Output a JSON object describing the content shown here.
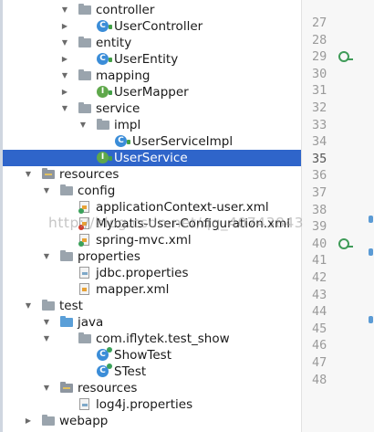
{
  "project_tree": {
    "selected_item": "UserService",
    "items": [
      {
        "label": "controller",
        "type": "folder",
        "expanded": true
      },
      {
        "label": "UserController",
        "type": "class",
        "icon": "class-icon"
      },
      {
        "label": "entity",
        "type": "folder",
        "expanded": true
      },
      {
        "label": "UserEntity",
        "type": "class",
        "icon": "class-icon"
      },
      {
        "label": "mapping",
        "type": "folder",
        "expanded": true
      },
      {
        "label": "UserMapper",
        "type": "interface",
        "icon": "interface-icon"
      },
      {
        "label": "service",
        "type": "folder",
        "expanded": true
      },
      {
        "label": "impl",
        "type": "folder",
        "expanded": true
      },
      {
        "label": "UserServiceImpl",
        "type": "class",
        "icon": "class-icon"
      },
      {
        "label": "UserService",
        "type": "interface",
        "icon": "interface-icon"
      },
      {
        "label": "resources",
        "type": "resources-folder",
        "expanded": true
      },
      {
        "label": "config",
        "type": "folder",
        "expanded": true
      },
      {
        "label": "applicationContext-user.xml",
        "type": "xml",
        "icon": "spring-xml-icon"
      },
      {
        "label": "Mybatis-User-Configuration.xml",
        "type": "xml",
        "icon": "mybatis-xml-icon"
      },
      {
        "label": "spring-mvc.xml",
        "type": "xml",
        "icon": "spring-xml-icon"
      },
      {
        "label": "properties",
        "type": "folder",
        "expanded": true
      },
      {
        "label": "jdbc.properties",
        "type": "properties",
        "icon": "properties-icon"
      },
      {
        "label": "mapper.xml",
        "type": "xml",
        "icon": "xml-icon"
      },
      {
        "label": "test",
        "type": "folder",
        "expanded": true
      },
      {
        "label": "java",
        "type": "source-folder",
        "expanded": true
      },
      {
        "label": "com.iflytek.test_show",
        "type": "folder",
        "expanded": true
      },
      {
        "label": "ShowTest",
        "type": "test-class",
        "icon": "test-class-icon"
      },
      {
        "label": "STest",
        "type": "test-class",
        "icon": "test-class-icon"
      },
      {
        "label": "resources",
        "type": "resources-folder",
        "expanded": true
      },
      {
        "label": "log4j.properties",
        "type": "properties",
        "icon": "properties-icon"
      },
      {
        "label": "webapp",
        "type": "folder",
        "expanded": false
      }
    ]
  },
  "editor_gutter": {
    "line_numbers": [
      "27",
      "28",
      "29",
      "30",
      "31",
      "32",
      "33",
      "34",
      "35",
      "36",
      "37",
      "38",
      "39",
      "40",
      "41",
      "42",
      "43",
      "44",
      "45",
      "46",
      "47",
      "48"
    ],
    "current_line": "35",
    "run_markers_on": [
      "29",
      "40"
    ]
  },
  "watermark": {
    "text": "http://blog.csdn.net/qq_40743843"
  },
  "colors": {
    "selection": "#2f65ca",
    "class_badge": "#3b8dd8",
    "interface_badge": "#5fa84b",
    "line_number": "#9a9a9a"
  }
}
